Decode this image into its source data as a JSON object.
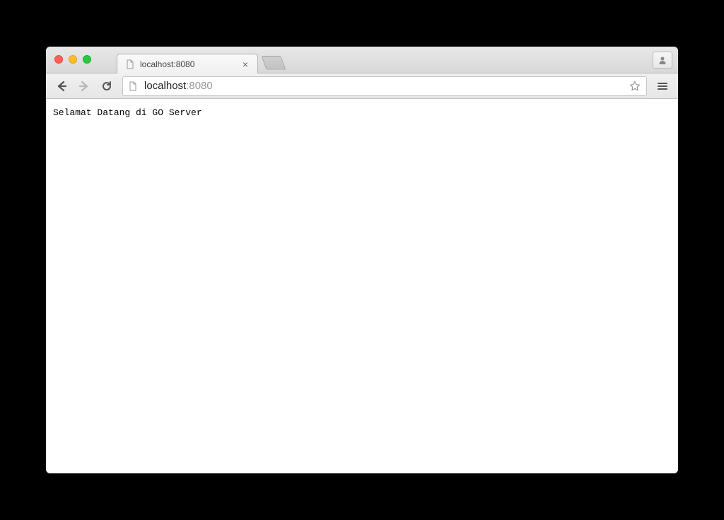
{
  "window": {
    "traffic_lights": {
      "close": "close",
      "minimize": "minimize",
      "maximize": "maximize"
    }
  },
  "tab": {
    "title": "localhost:8080"
  },
  "addressbar": {
    "host": "localhost",
    "port": ":8080"
  },
  "page": {
    "body_text": "Selamat Datang di GO Server"
  },
  "icons": {
    "close_tab": "×"
  }
}
